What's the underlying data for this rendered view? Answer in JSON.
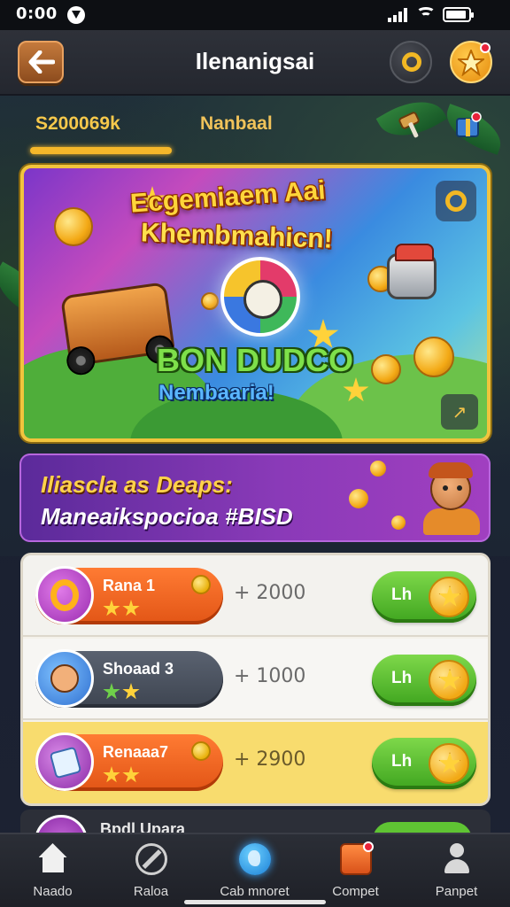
{
  "status_bar": {
    "time": "0:00"
  },
  "header": {
    "title": "Ilenanigsai"
  },
  "tabs": [
    {
      "label": "S200069k"
    },
    {
      "label": "Nanbaal"
    }
  ],
  "hero": {
    "headline_1": "Ecgemiaem Aai",
    "headline_2": "Khembmahicn!",
    "promo_1": "BON DUDCO",
    "promo_2": "Nembaaria!"
  },
  "promo_banner": {
    "line_1": "Iliascla as Deaps:",
    "line_2": "Maneaikspocioa #BISD"
  },
  "list_items": [
    {
      "name": "Rana 1",
      "price": "+ 2000",
      "button": "Lh",
      "stars": 2
    },
    {
      "name": "Shoaad 3",
      "price": "+ 1000",
      "button": "Lh",
      "stars": 2
    },
    {
      "name": "Renaaa7",
      "price": "+ 2900",
      "button": "Lh",
      "stars": 2
    }
  ],
  "peek_item": {
    "label": "Bpdl Upara"
  },
  "nav": [
    {
      "label": "Naado",
      "icon": "home-icon"
    },
    {
      "label": "Raloa",
      "icon": "compass-icon"
    },
    {
      "label": "Cab mnoret",
      "icon": "globe-icon"
    },
    {
      "label": "Compet",
      "icon": "chest-icon"
    },
    {
      "label": "Panpet",
      "icon": "user-icon"
    }
  ],
  "colors": {
    "accent_gold": "#f5b72a",
    "go_green": "#5fc433",
    "pill_orange": "#ff7b33",
    "promo_purple": "#8a3ab8"
  }
}
